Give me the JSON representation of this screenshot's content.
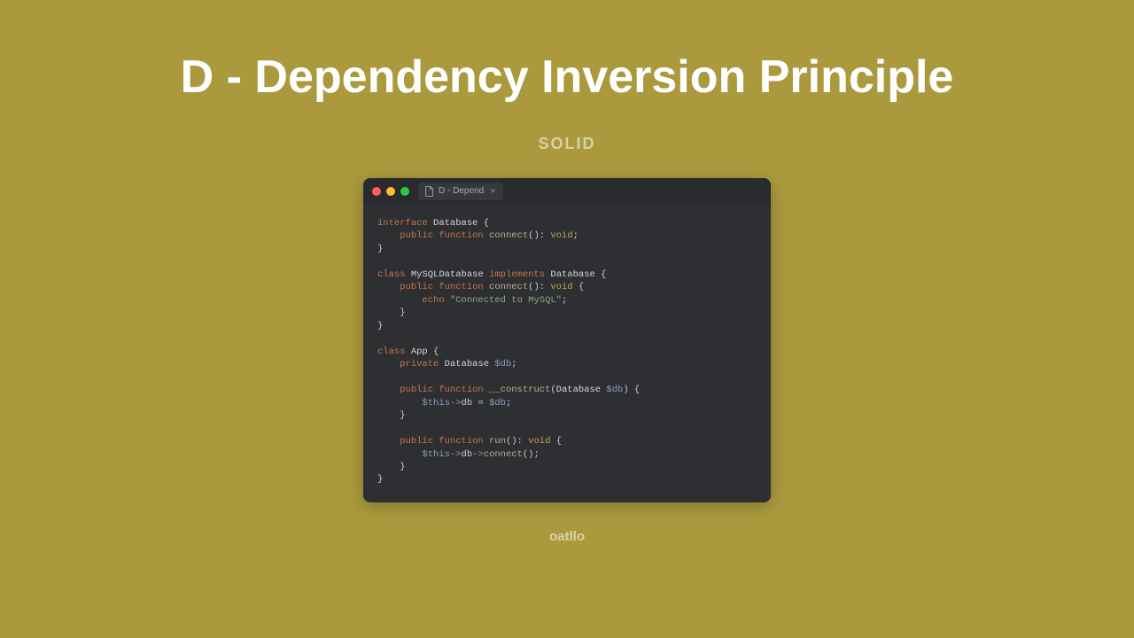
{
  "title": "D - Dependency Inversion Principle",
  "subtitle": "SOLID",
  "footer": "oatllo",
  "editor": {
    "tab_label": "D - Depend",
    "code_tokens": [
      [
        [
          "kw",
          "interface"
        ],
        [
          "plain",
          " "
        ],
        [
          "name",
          "Database"
        ],
        [
          "plain",
          " {"
        ]
      ],
      [
        [
          "plain",
          "    "
        ],
        [
          "kw",
          "public function"
        ],
        [
          "plain",
          " "
        ],
        [
          "fn",
          "connect"
        ],
        [
          "plain",
          "(): "
        ],
        [
          "type",
          "void"
        ],
        [
          "plain",
          ";"
        ]
      ],
      [
        [
          "plain",
          "}"
        ]
      ],
      [],
      [
        [
          "kw",
          "class"
        ],
        [
          "plain",
          " "
        ],
        [
          "name",
          "MySQLDatabase"
        ],
        [
          "plain",
          " "
        ],
        [
          "kw",
          "implements"
        ],
        [
          "plain",
          " "
        ],
        [
          "name",
          "Database"
        ],
        [
          "plain",
          " {"
        ]
      ],
      [
        [
          "plain",
          "    "
        ],
        [
          "kw",
          "public function"
        ],
        [
          "plain",
          " "
        ],
        [
          "fn",
          "connect"
        ],
        [
          "plain",
          "(): "
        ],
        [
          "type",
          "void"
        ],
        [
          "plain",
          " {"
        ]
      ],
      [
        [
          "plain",
          "        "
        ],
        [
          "kw",
          "echo"
        ],
        [
          "plain",
          " "
        ],
        [
          "str",
          "\"Connected to MySQL\""
        ],
        [
          "plain",
          ";"
        ]
      ],
      [
        [
          "plain",
          "    }"
        ]
      ],
      [
        [
          "plain",
          "}"
        ]
      ],
      [],
      [
        [
          "kw",
          "class"
        ],
        [
          "plain",
          " "
        ],
        [
          "name",
          "App"
        ],
        [
          "plain",
          " {"
        ]
      ],
      [
        [
          "plain",
          "    "
        ],
        [
          "kw",
          "private"
        ],
        [
          "plain",
          " "
        ],
        [
          "name",
          "Database"
        ],
        [
          "plain",
          " "
        ],
        [
          "var",
          "$db"
        ],
        [
          "plain",
          ";"
        ]
      ],
      [],
      [
        [
          "plain",
          "    "
        ],
        [
          "kw",
          "public function"
        ],
        [
          "plain",
          " "
        ],
        [
          "fn",
          "__construct"
        ],
        [
          "plain",
          "("
        ],
        [
          "name",
          "Database"
        ],
        [
          "plain",
          " "
        ],
        [
          "var",
          "$db"
        ],
        [
          "plain",
          ") {"
        ]
      ],
      [
        [
          "plain",
          "        "
        ],
        [
          "var",
          "$this"
        ],
        [
          "arrow",
          "->"
        ],
        [
          "plain",
          "db = "
        ],
        [
          "var",
          "$db"
        ],
        [
          "plain",
          ";"
        ]
      ],
      [
        [
          "plain",
          "    }"
        ]
      ],
      [],
      [
        [
          "plain",
          "    "
        ],
        [
          "kw",
          "public function"
        ],
        [
          "plain",
          " "
        ],
        [
          "fn",
          "run"
        ],
        [
          "plain",
          "(): "
        ],
        [
          "type",
          "void"
        ],
        [
          "plain",
          " {"
        ]
      ],
      [
        [
          "plain",
          "        "
        ],
        [
          "var",
          "$this"
        ],
        [
          "arrow",
          "->"
        ],
        [
          "plain",
          "db"
        ],
        [
          "arrow",
          "->"
        ],
        [
          "fn",
          "connect"
        ],
        [
          "plain",
          "();"
        ]
      ],
      [
        [
          "plain",
          "    }"
        ]
      ],
      [
        [
          "plain",
          "}"
        ]
      ]
    ]
  }
}
